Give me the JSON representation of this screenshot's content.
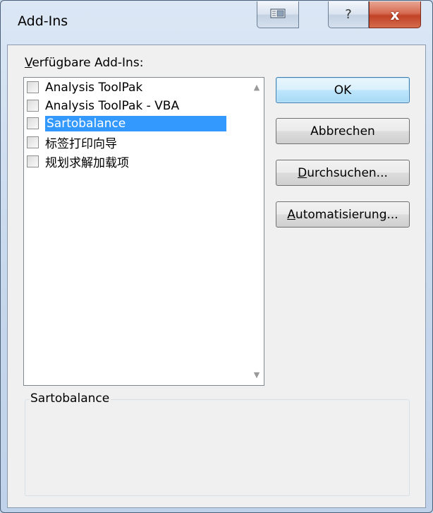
{
  "window": {
    "title": "Add-Ins",
    "help_glyph": "?",
    "close_glyph": "x"
  },
  "list": {
    "label_prefix": "V",
    "label_rest": "erfügbare Add-Ins:",
    "items": [
      {
        "label": "Analysis ToolPak",
        "checked": false,
        "selected": false
      },
      {
        "label": "Analysis ToolPak - VBA",
        "checked": false,
        "selected": false
      },
      {
        "label": "Sartobalance",
        "checked": false,
        "selected": true
      },
      {
        "label": "标签打印向导",
        "checked": false,
        "selected": false
      },
      {
        "label": "规划求解加载项",
        "checked": false,
        "selected": false
      }
    ]
  },
  "buttons": {
    "ok": "OK",
    "cancel": "Abbrechen",
    "browse_prefix": "D",
    "browse_rest": "urchsuchen...",
    "automation_prefix": "A",
    "automation_rest": "utomatisierung..."
  },
  "description": {
    "title": "Sartobalance"
  }
}
